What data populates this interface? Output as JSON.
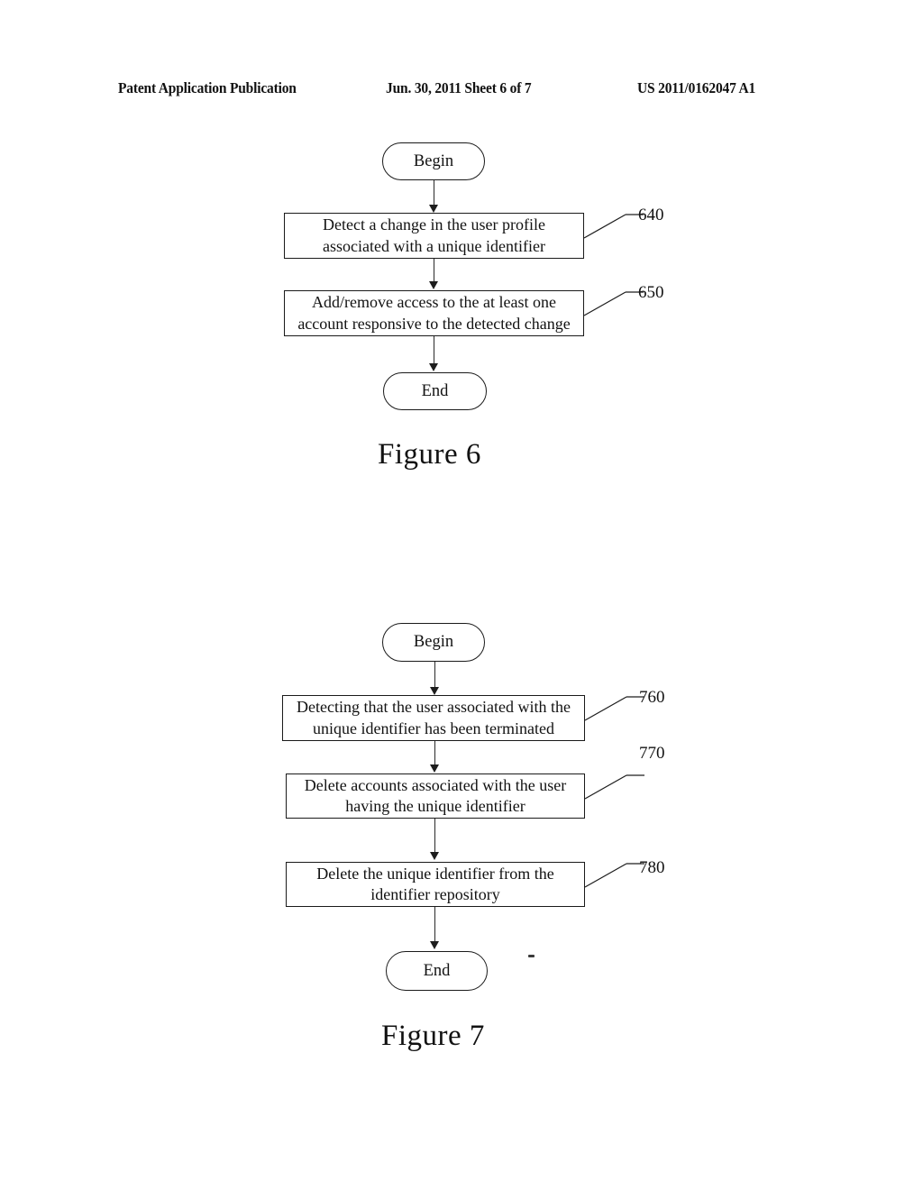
{
  "header": {
    "left": "Patent Application Publication",
    "middle": "Jun. 30, 2011  Sheet 6 of 7",
    "right": "US 2011/0162047 A1"
  },
  "figures": [
    {
      "caption": "Figure 6",
      "start_label": "Begin",
      "end_label": "End",
      "steps": [
        {
          "ref": "640",
          "lines": [
            "Detect a change in the user profile",
            "associated with a unique identifier"
          ]
        },
        {
          "ref": "650",
          "lines": [
            "Add/remove access to the at least one",
            "account responsive to the detected change"
          ]
        }
      ]
    },
    {
      "caption": "Figure 7",
      "start_label": "Begin",
      "end_label": "End",
      "steps": [
        {
          "ref": "760",
          "lines": [
            "Detecting that the user associated with the",
            "unique identifier has been terminated"
          ]
        },
        {
          "ref": "770",
          "lines": [
            "Delete accounts associated with the user",
            "having the unique identifier"
          ]
        },
        {
          "ref": "780",
          "lines": [
            "Delete the unique identifier from the",
            "identifier repository"
          ]
        }
      ]
    }
  ]
}
